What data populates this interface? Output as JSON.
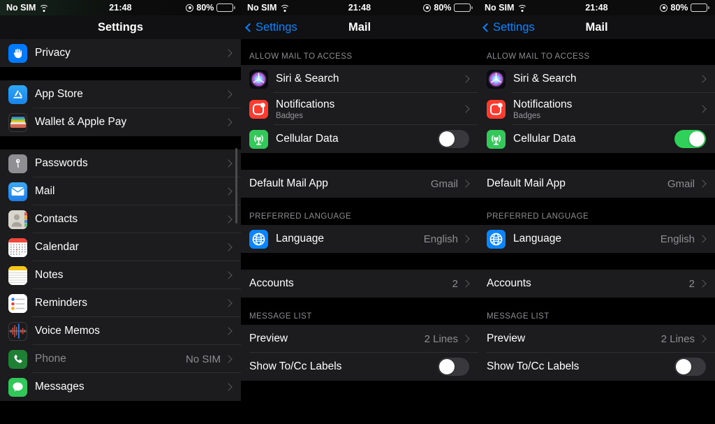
{
  "status_bar": {
    "carrier": "No SIM",
    "time": "21:48",
    "battery_pct": "80%",
    "wifi_icon": "wifi-icon",
    "location_icon": "location-services-icon",
    "battery_icon": "battery-icon"
  },
  "sidebar": {
    "title": "Settings",
    "groups": [
      {
        "rows": [
          {
            "label": "Privacy",
            "icon": "privacy-hand-icon",
            "accessory": "chevron"
          }
        ]
      },
      {
        "rows": [
          {
            "label": "App Store",
            "icon": "app-store-icon",
            "accessory": "chevron"
          },
          {
            "label": "Wallet & Apple Pay",
            "icon": "wallet-icon",
            "accessory": "chevron"
          }
        ]
      },
      {
        "rows": [
          {
            "label": "Passwords",
            "icon": "passwords-key-icon",
            "accessory": "chevron"
          },
          {
            "label": "Mail",
            "icon": "mail-envelope-icon",
            "accessory": "chevron"
          },
          {
            "label": "Contacts",
            "icon": "contacts-icon",
            "accessory": "chevron"
          },
          {
            "label": "Calendar",
            "icon": "calendar-icon",
            "accessory": "chevron"
          },
          {
            "label": "Notes",
            "icon": "notes-icon",
            "accessory": "chevron"
          },
          {
            "label": "Reminders",
            "icon": "reminders-icon",
            "accessory": "chevron"
          },
          {
            "label": "Voice Memos",
            "icon": "voice-memos-icon",
            "accessory": "chevron"
          },
          {
            "label": "Phone",
            "icon": "phone-icon",
            "value": "No SIM",
            "dim": true,
            "accessory": "chevron"
          },
          {
            "label": "Messages",
            "icon": "messages-icon",
            "accessory": "chevron"
          }
        ]
      }
    ]
  },
  "mail_panel": {
    "back_label": "Settings",
    "title": "Mail",
    "sections": [
      {
        "header": "ALLOW MAIL TO ACCESS",
        "rows": [
          {
            "label": "Siri & Search",
            "icon": "siri-icon",
            "accessory": "chevron"
          },
          {
            "label": "Notifications",
            "sublabel": "Badges",
            "icon": "notifications-icon",
            "accessory": "chevron"
          },
          {
            "label": "Cellular Data",
            "icon": "cellular-data-icon",
            "accessory": "toggle",
            "toggle_on": false
          }
        ]
      },
      {
        "header": "",
        "rows": [
          {
            "label": "Default Mail App",
            "value": "Gmail",
            "accessory": "chevron"
          }
        ]
      },
      {
        "header": "PREFERRED LANGUAGE",
        "rows": [
          {
            "label": "Language",
            "icon": "language-globe-icon",
            "value": "English",
            "accessory": "chevron"
          }
        ]
      },
      {
        "header": "",
        "rows": [
          {
            "label": "Accounts",
            "value": "2",
            "accessory": "chevron"
          }
        ]
      },
      {
        "header": "MESSAGE LIST",
        "rows": [
          {
            "label": "Preview",
            "value": "2 Lines",
            "accessory": "chevron"
          },
          {
            "label": "Show To/Cc Labels",
            "accessory": "toggle",
            "toggle_on": false
          }
        ]
      }
    ]
  },
  "mail_panel_right": {
    "back_label": "Settings",
    "title": "Mail",
    "sections": [
      {
        "header": "ALLOW MAIL TO ACCESS",
        "rows": [
          {
            "label": "Siri & Search",
            "icon": "siri-icon",
            "accessory": "chevron"
          },
          {
            "label": "Notifications",
            "sublabel": "Badges",
            "icon": "notifications-icon",
            "accessory": "chevron"
          },
          {
            "label": "Cellular Data",
            "icon": "cellular-data-icon",
            "accessory": "toggle",
            "toggle_on": true
          }
        ]
      },
      {
        "header": "",
        "rows": [
          {
            "label": "Default Mail App",
            "value": "Gmail",
            "accessory": "chevron"
          }
        ]
      },
      {
        "header": "PREFERRED LANGUAGE",
        "rows": [
          {
            "label": "Language",
            "icon": "language-globe-icon",
            "value": "English",
            "accessory": "chevron"
          }
        ]
      },
      {
        "header": "",
        "rows": [
          {
            "label": "Accounts",
            "value": "2",
            "accessory": "chevron"
          }
        ]
      },
      {
        "header": "MESSAGE LIST",
        "rows": [
          {
            "label": "Preview",
            "value": "2 Lines",
            "accessory": "chevron"
          },
          {
            "label": "Show To/Cc Labels",
            "accessory": "toggle",
            "toggle_on": false
          }
        ]
      }
    ]
  },
  "colors": {
    "accent_blue": "#0a84ff",
    "toggle_on_green": "#30d158",
    "row_bg": "#1c1c1e",
    "separator": "#2e2e31",
    "secondary_text": "#8e8e93"
  }
}
